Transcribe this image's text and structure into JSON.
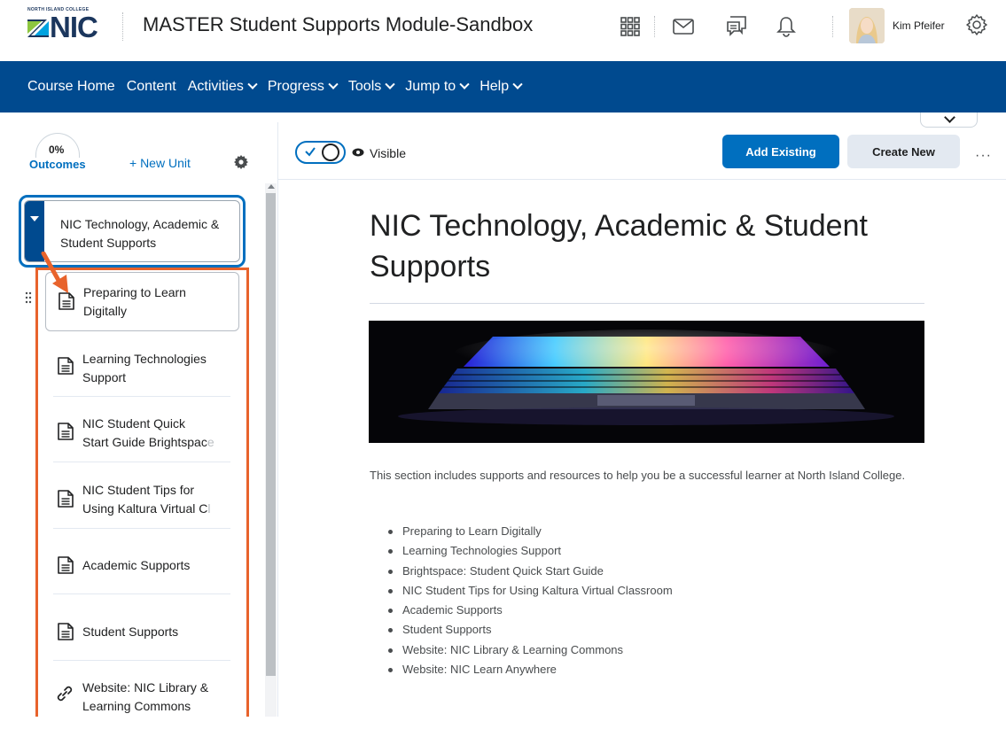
{
  "header": {
    "logo_small": "NORTH ISLAND COLLEGE",
    "logo_text": "NIC",
    "course_title": "MASTER Student Supports Module-Sandbox",
    "icons": [
      "grid-icon",
      "mail-icon",
      "chat-icon",
      "bell-icon"
    ],
    "user_name": "Kim Pfeifer"
  },
  "nav": {
    "items": [
      {
        "label": "Course Home",
        "dropdown": false
      },
      {
        "label": "Content",
        "dropdown": false
      },
      {
        "label": "Activities",
        "dropdown": true
      },
      {
        "label": "Progress",
        "dropdown": true
      },
      {
        "label": "Tools",
        "dropdown": true
      },
      {
        "label": "Jump to",
        "dropdown": true
      },
      {
        "label": "Help",
        "dropdown": true
      }
    ]
  },
  "left": {
    "progress": "0%",
    "outcomes": "Outcomes",
    "new_unit": "+ New Unit",
    "unit_title": "NIC Technology, Academic & Student Supports",
    "topics": [
      {
        "line1": "Preparing to Learn",
        "line2": "Digitally",
        "fade": "",
        "icon": "document-icon",
        "selected": true
      },
      {
        "line1": "Learning Technologies",
        "line2": "Support",
        "fade": "",
        "icon": "document-icon",
        "selected": false
      },
      {
        "line1": "NIC Student Quick",
        "line2": "Start Guide Brightspac",
        "fade": "e",
        "icon": "document-icon",
        "selected": false
      },
      {
        "line1": "NIC Student Tips for",
        "line2": "Using Kaltura Virtual C",
        "fade": "l",
        "icon": "document-icon",
        "selected": false
      },
      {
        "line1": "Academic Supports",
        "line2": "",
        "fade": "",
        "icon": "document-icon",
        "selected": false
      },
      {
        "line1": "Student Supports",
        "line2": "",
        "fade": "",
        "icon": "document-icon",
        "selected": false
      },
      {
        "line1": "Website: NIC Library &",
        "line2": "Learning Commons",
        "fade": "",
        "icon": "link-icon",
        "selected": false
      }
    ]
  },
  "main": {
    "visibility": "Visible",
    "add_existing": "Add Existing",
    "create_new": "Create New",
    "more": "···",
    "title": "NIC Technology, Academic & Student Supports",
    "intro": "This section includes supports and resources to help you be a successful learner at North Island College.",
    "list": [
      "Preparing to Learn Digitally",
      "Learning Technologies Support",
      "Brightspace: Student Quick Start Guide",
      "NIC Student Tips for Using Kaltura Virtual Classroom",
      "Academic Supports",
      "Student Supports",
      "Website: NIC Library & Learning Commons",
      "Website: NIC Learn Anywhere"
    ]
  },
  "colors": {
    "brand_blue": "#004a8f",
    "link_blue": "#006fbf",
    "highlight_orange": "#e8632c"
  }
}
